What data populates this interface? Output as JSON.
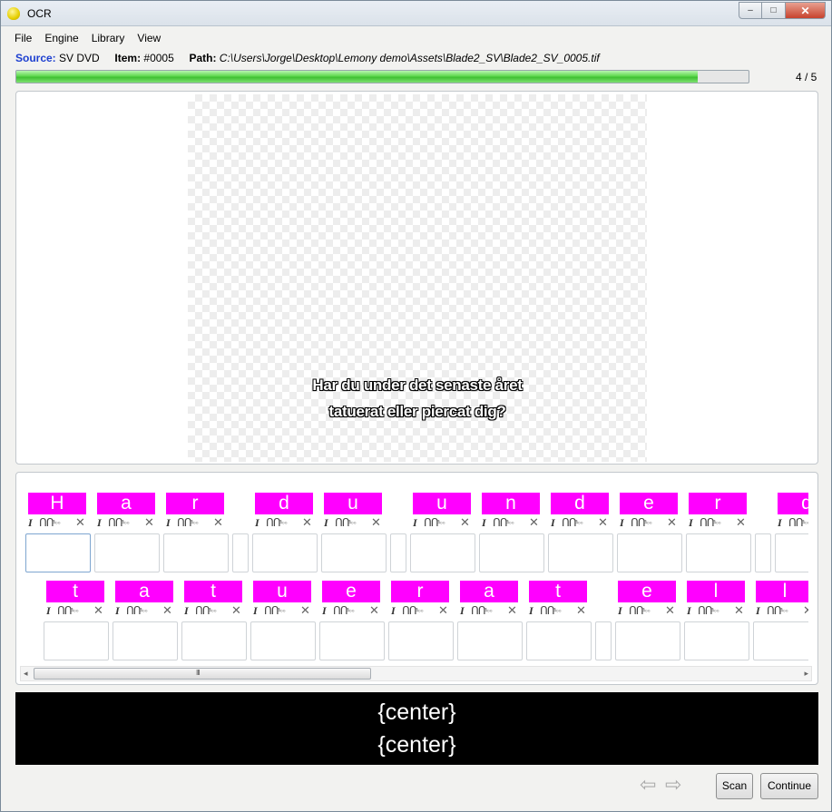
{
  "window": {
    "title": "OCR",
    "min_glyph": "–",
    "max_glyph": "□",
    "close_glyph": "✕"
  },
  "menu": [
    "File",
    "Engine",
    "Library",
    "View"
  ],
  "info": {
    "source_label": "Source:",
    "source_value": "SV DVD",
    "item_label": "Item:",
    "item_value": "#0005",
    "path_label": "Path:",
    "path_value": "C:\\Users\\Jorge\\Desktop\\Lemony demo\\Assets\\Blade2_SV\\Blade2_SV_0005.tif"
  },
  "progress": {
    "current": 4,
    "total": 5,
    "text": "4 / 5",
    "fill_fraction": 0.93
  },
  "image": {
    "lines": [
      "Har du under det senaste året",
      "tatuerat eller piercat dig?"
    ]
  },
  "glyph_tools": {
    "italic": "I",
    "bars": "ᑎᑎ",
    "sub": "a₀₀",
    "delete": "✕"
  },
  "glyph_rows": [
    {
      "cells": [
        "H",
        "a",
        "r",
        " ",
        "d",
        "u",
        " ",
        "u",
        "n",
        "d",
        "e",
        "r",
        " ",
        "d"
      ]
    },
    {
      "cells": [
        "t",
        "a",
        "t",
        "u",
        "e",
        "r",
        "a",
        "t",
        " ",
        "e",
        "l",
        "l"
      ]
    }
  ],
  "scrollbar": {
    "left_arrow": "◂",
    "right_arrow": "▸",
    "grip": "III"
  },
  "preview": {
    "lines": [
      "{center}",
      " {center}"
    ]
  },
  "nav": {
    "back_icon": "⇦",
    "forward_icon": "⇨"
  },
  "buttons": {
    "scan": "Scan",
    "continue": "Continue"
  }
}
